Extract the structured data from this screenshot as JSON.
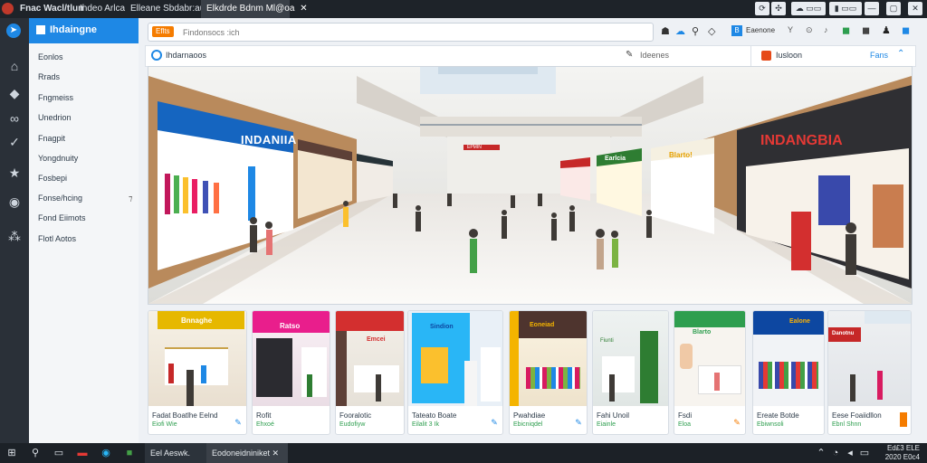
{
  "titlebar": {
    "app_title": "Fnac Wacl/tlun",
    "tabs": [
      "Ihdeo Arlca",
      "Elleane Sbdabr:auk",
      "Elkdrde Bdnm Ml@oa"
    ],
    "active_tab_index": 2,
    "close_glyph": "✕"
  },
  "window_controls": {
    "icons": [
      "sync-icon",
      "puzzle-icon",
      "weather-icon",
      "blue-app-icon",
      "minimize-icon",
      "maximize-icon",
      "close-icon"
    ],
    "glyphs": [
      "⟳",
      "✣",
      "☁ ▭▭",
      "▮ ▭▭",
      "—",
      "▢",
      "✕"
    ]
  },
  "sidebar": {
    "title": "Ihdaingne",
    "items": [
      "Eonlos",
      "Rrads",
      "Fngmeiss",
      "Unedrion",
      "Fnagpit",
      "Yongdnuity",
      "Fosbepi",
      "Fonse/hcing",
      "Fond Eiimots",
      "Flotl Aotos"
    ],
    "submenu_marker": "⁊"
  },
  "rail_icons": [
    "compass-icon",
    "store-icon",
    "tag-icon",
    "link-icon",
    "check-icon",
    "star-icon",
    "chat-icon",
    "grid-icon"
  ],
  "search": {
    "badge": "Eflts",
    "placeholder": "Findonsocs :ich"
  },
  "toolbar_right": {
    "icons": [
      "pin-icon",
      "cloud-icon",
      "filter-icon",
      "tag-icon"
    ],
    "items": [
      {
        "badge": "B",
        "label": "Eaenone",
        "color": "#1e88e5"
      },
      {
        "badge": "Y",
        "label": "",
        "color": "#555"
      },
      {
        "badge": "⊙",
        "label": "",
        "color": "#555"
      },
      {
        "badge": "♪",
        "label": "",
        "color": "#555"
      },
      {
        "badge": "◼",
        "label": "",
        "color": "#2e9e4f"
      },
      {
        "badge": "◼",
        "label": "",
        "color": "#444"
      },
      {
        "badge": "♟",
        "label": "",
        "color": "#222"
      },
      {
        "badge": "◼",
        "label": "",
        "color": "#1e88e5"
      }
    ]
  },
  "secondary_bar": {
    "left_label": "Ihdarnaoos",
    "center_label": "Ideenes",
    "right_label": "Iusloon",
    "right_link": "Fans"
  },
  "hero": {
    "left_store_sign": "INDANIIA",
    "right_store_sign": "INDANGBIA",
    "small_sign_1": "Blarto!",
    "small_sign_2": "Earlcia",
    "center_sign": "EPMIN"
  },
  "cards": [
    {
      "sign": "Bnnaghe",
      "title": "Fadat Boatlhe Eelnd",
      "price": "Eiofi Wie",
      "sign_color": "#e6b800",
      "edit": "✎"
    },
    {
      "sign": "Ratso",
      "title": "Rofit",
      "price": "Ehxoé",
      "sign_color": "#e91e8c",
      "edit": ""
    },
    {
      "sign": "Emcei",
      "title": "Fooralotic",
      "price": "Eudofiyw",
      "sign_color": "#d32f2f",
      "edit": ""
    },
    {
      "sign": "Sindion",
      "title": "Tateato Boate",
      "price": "Eilalit 3 Ik",
      "sign_color": "#1e88e5",
      "edit": "✎"
    },
    {
      "sign": "Eoneiad",
      "title": "Pwahdiae",
      "price": "Ebicniqdel",
      "sign_color": "#f4b400",
      "edit": "✎"
    },
    {
      "sign": "Fiunti",
      "title": "Fahi Unoil",
      "price": "Eiainle",
      "sign_color": "#2e7d32",
      "edit": ""
    },
    {
      "sign": "Blarto",
      "title": "Fsdi",
      "price": "Eloa",
      "sign_color": "#2e9e4f",
      "edit": "✎"
    },
    {
      "sign": "Ealone",
      "title": "Ereate Botde",
      "price": "Ebiwnsoli",
      "sign_color": "#0d47a1",
      "edit": ""
    },
    {
      "sign": "Danotnu",
      "title": "Eese Foaiidllon",
      "price": "Ebnl Shnn",
      "sign_color": "#c62828",
      "edit": "▮"
    }
  ],
  "taskbar": {
    "start_glyph": "⊞",
    "tasks": [
      "Eel Aeswk.",
      "Eodoneidniniket ✕"
    ],
    "clock_line1": "Ed£3 ELE",
    "clock_line2": "2020 E0c4"
  }
}
